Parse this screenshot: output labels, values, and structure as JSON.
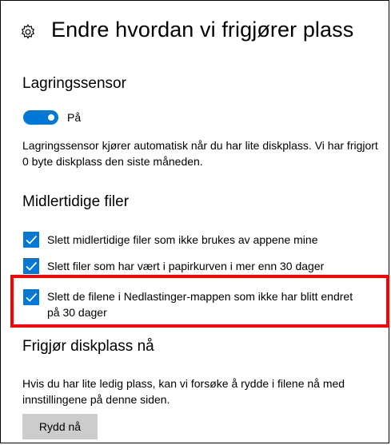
{
  "header": {
    "title": "Endre hvordan vi frigjører plass",
    "icon": "gear-icon"
  },
  "storage_sense": {
    "title": "Lagringssensor",
    "toggle_state": "on",
    "toggle_label": "På",
    "description": "Lagringssensor kjører automatisk når du har lite diskplass. Vi har frigjort 0 byte diskplass den siste måneden."
  },
  "temp_files": {
    "title": "Midlertidige filer",
    "options": [
      {
        "label": "Slett midlertidige filer som ikke brukes av appene mine",
        "checked": true
      },
      {
        "label": "Slett filer som har vært i papirkurven i mer enn 30 dager",
        "checked": true
      },
      {
        "label_line1": "Slett de filene i Nedlastinger-mappen som ikke har blitt endret",
        "label_line2": "på 30 dager",
        "checked": true
      }
    ]
  },
  "free_space": {
    "title": "Frigjør diskplass nå",
    "description": "Hvis du har lite ledig plass, kan vi forsøke å rydde i filene nå med innstillingene på denne siden.",
    "button_label": "Rydd nå"
  },
  "colors": {
    "accent": "#0078d7",
    "highlight": "#ff0000",
    "button_bg": "#cccccc"
  }
}
